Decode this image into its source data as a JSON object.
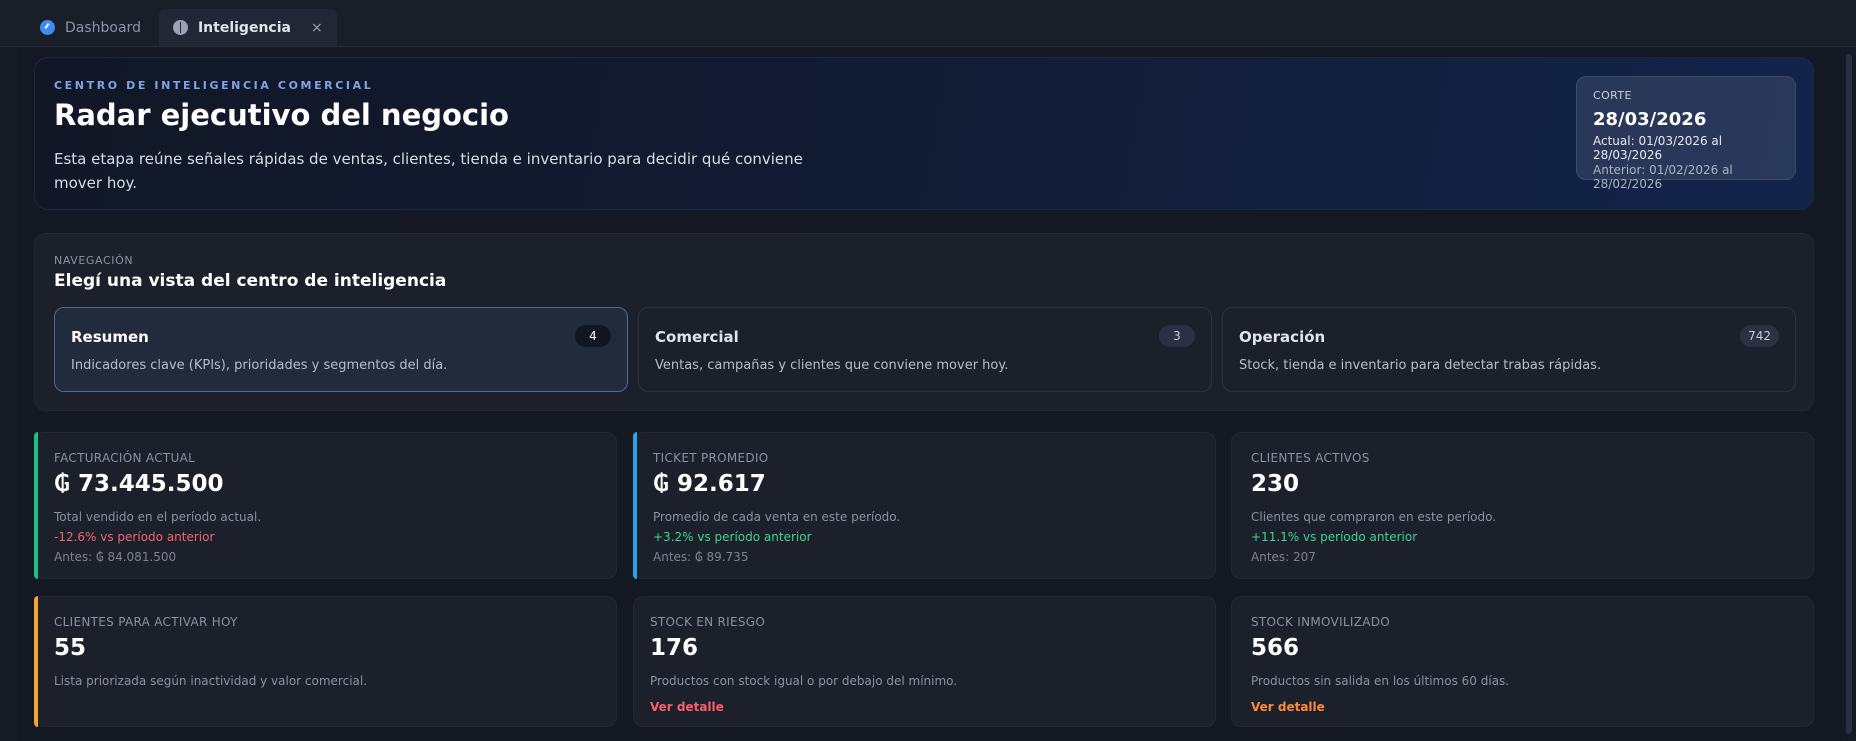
{
  "tabs": [
    {
      "label": "Dashboard",
      "icon": "gauge-icon",
      "active": false
    },
    {
      "label": "Inteligencia",
      "icon": "brain-icon",
      "active": true,
      "close": "×"
    }
  ],
  "hero": {
    "kicker": "CENTRO DE INTELIGENCIA COMERCIAL",
    "title": "Radar ejecutivo del negocio",
    "description": "Esta etapa reúne señales rápidas de ventas, clientes, tienda e inventario para decidir qué conviene mover hoy.",
    "cut": {
      "label": "CORTE",
      "date": "28/03/2026",
      "actual": "Actual: 01/03/2026 al 28/03/2026",
      "previous": "Anterior: 01/02/2026 al 28/02/2026"
    }
  },
  "navigation": {
    "kicker": "NAVEGACIÓN",
    "title": "Elegí una vista del centro de inteligencia",
    "cards": [
      {
        "title": "Resumen",
        "badge": "4",
        "description": "Indicadores clave (KPIs), prioridades y segmentos del día.",
        "active": true
      },
      {
        "title": "Comercial",
        "badge": "3",
        "description": "Ventas, campañas y clientes que conviene mover hoy.",
        "active": false
      },
      {
        "title": "Operación",
        "badge": "742",
        "description": "Stock, tienda e inventario para detectar trabas rápidas.",
        "active": false
      }
    ]
  },
  "kpis": {
    "billing": {
      "label": "FACTURACIÓN ACTUAL",
      "value": "₲ 73.445.500",
      "description": "Total vendido en el período actual.",
      "change": "-12.6% vs período anterior",
      "previous": "Antes: ₲ 84.081.500",
      "accent": "#1fbf84"
    },
    "ticket": {
      "label": "TICKET PROMEDIO",
      "value": "₲ 92.617",
      "description": "Promedio de cada venta en este período.",
      "change": "+3.2% vs período anterior",
      "previous": "Antes: ₲ 89.735",
      "accent": "#2aa3e6"
    },
    "clients": {
      "label": "CLIENTES ACTIVOS",
      "value": "230",
      "description": "Clientes que compraron en este período.",
      "change": "+11.1% vs período anterior",
      "previous": "Antes: 207"
    },
    "activate": {
      "label": "CLIENTES PARA ACTIVAR HOY",
      "value": "55",
      "description": "Lista priorizada según inactividad y valor comercial.",
      "accent": "#f2a62a"
    },
    "risk": {
      "label": "STOCK EN RIESGO",
      "value": "176",
      "description": "Productos con stock igual o por debajo del mínimo.",
      "link": "Ver detalle",
      "link_color": "#ff5c6c"
    },
    "idle": {
      "label": "STOCK INMOVILIZADO",
      "value": "566",
      "description": "Productos sin salida en los últimos 60 días.",
      "link": "Ver detalle",
      "link_color": "#ff8a3d"
    }
  }
}
